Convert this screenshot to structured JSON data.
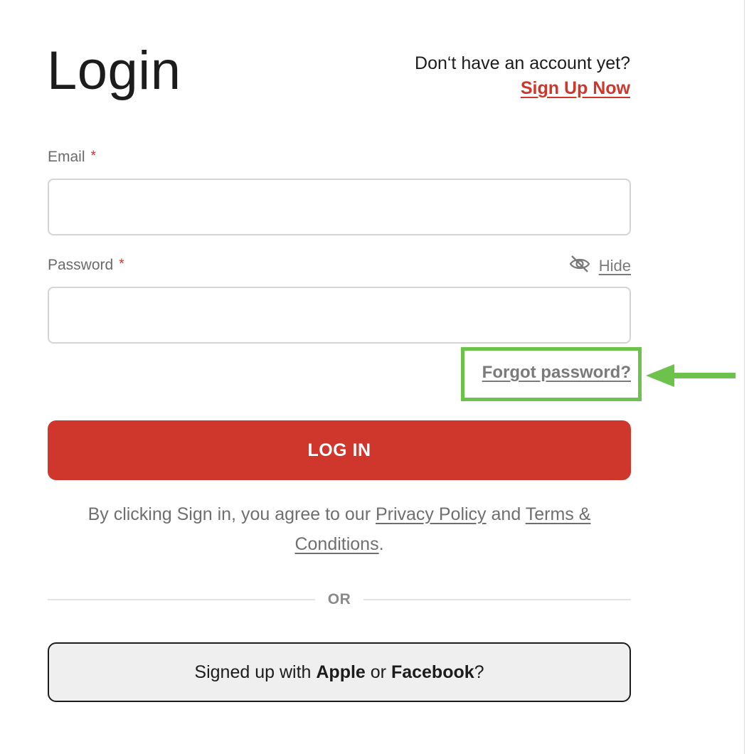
{
  "header": {
    "title": "Login",
    "signup_prompt": "Don‘t have an account yet?",
    "signup_link": "Sign Up Now"
  },
  "form": {
    "email": {
      "label": "Email",
      "required_mark": "*",
      "value": "",
      "placeholder": ""
    },
    "password": {
      "label": "Password",
      "required_mark": "*",
      "value": "",
      "placeholder": "",
      "toggle_label": "Hide",
      "toggle_icon": "eye-slash-icon"
    },
    "forgot_password": "Forgot password?",
    "submit_label": "LOG IN"
  },
  "legal": {
    "prefix": "By clicking Sign in, you agree to our ",
    "privacy_link": "Privacy Policy",
    "and": " and ",
    "terms_link": "Terms & Conditions",
    "suffix": "."
  },
  "divider": {
    "label": "OR"
  },
  "social": {
    "prefix": "Signed up with ",
    "apple": "Apple",
    "or": " or ",
    "facebook": "Facebook",
    "suffix": "?"
  },
  "annotation": {
    "highlight_color": "#6cc24a",
    "arrow_icon": "arrow-left-icon"
  },
  "colors": {
    "accent": "#cf372d",
    "secondary_button_bg": "#efefef"
  }
}
